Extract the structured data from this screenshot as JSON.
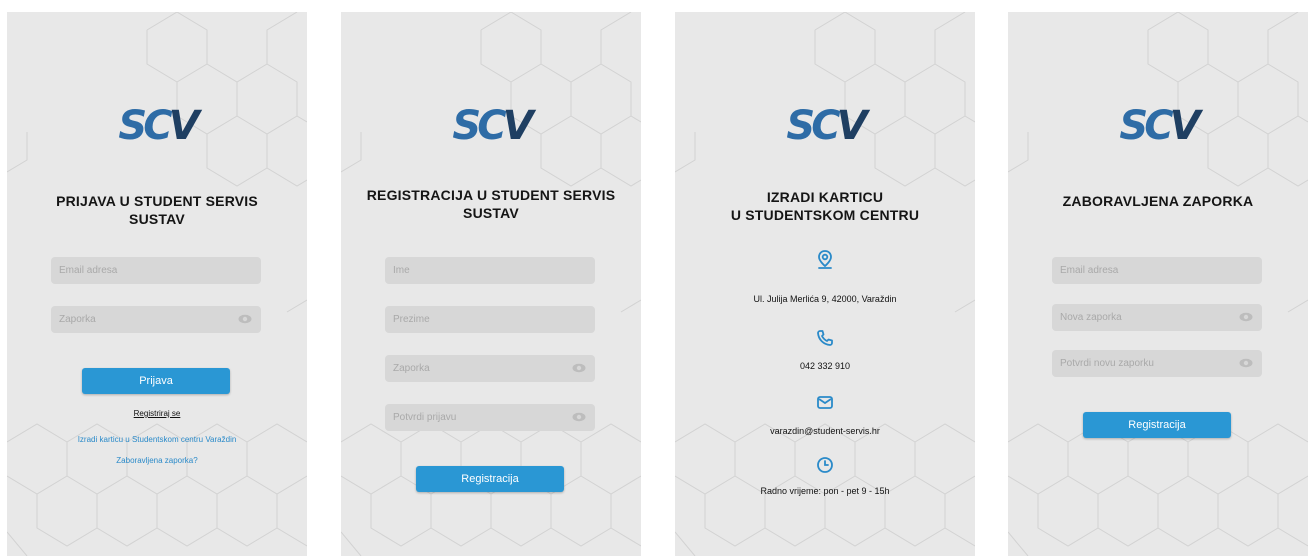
{
  "logo": {
    "s": "S",
    "c": "C",
    "v": "V"
  },
  "login": {
    "title": "PRIJAVA U STUDENT SERVIS SUSTAV",
    "email_placeholder": "Email adresa",
    "password_placeholder": "Zaporka",
    "submit_label": "Prijava",
    "register_link": "Registriraj se",
    "card_link": "Izradi karticu u Studentskom centru Varaždin",
    "forgot_link": "Zaboravljena zaporka?"
  },
  "register": {
    "title": "REGISTRACIJA U STUDENT SERVIS SUSTAV",
    "first_name_placeholder": "Ime",
    "last_name_placeholder": "Prezime",
    "password_placeholder": "Zaporka",
    "confirm_placeholder": "Potvrdi prijavu",
    "submit_label": "Registracija"
  },
  "card": {
    "title_line1": "IZRADI KARTICU",
    "title_line2": "U STUDENTSKOM CENTRU",
    "address": "Ul. Julija Merlića 9, 42000, Varaždin",
    "phone": "042 332 910",
    "email": "varazdin@student-servis.hr",
    "hours": "Radno vrijeme: pon - pet 9 - 15h",
    "icons": [
      "location-icon",
      "phone-icon",
      "mail-icon",
      "clock-icon"
    ]
  },
  "forgot": {
    "title": "ZABORAVLJENA ZAPORKA",
    "email_placeholder": "Email adresa",
    "new_password_placeholder": "Nova zaporka",
    "confirm_password_placeholder": "Potvrdi novu zaporku",
    "submit_label": "Registracija"
  },
  "colors": {
    "accent": "#2a97d4",
    "logo_light": "#2e6ca6",
    "logo_dark": "#1f3f62",
    "background": "#e8e8e8"
  }
}
